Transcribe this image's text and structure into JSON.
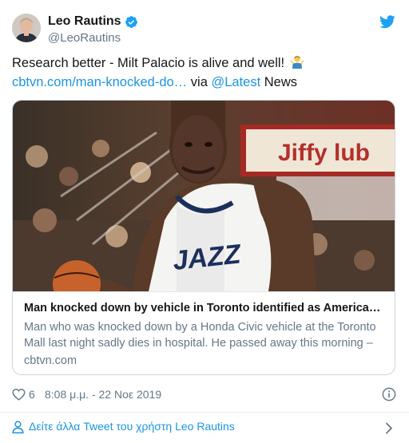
{
  "author": {
    "display_name": "Leo Rautins",
    "handle": "@LeoRautins",
    "verified_icon": "verified-badge-icon",
    "avatar_icon": "avatar"
  },
  "brand_icon": "twitter-bird-icon",
  "tweet": {
    "text_before": "Research better - Milt Palacio is alive and well! ",
    "emoji": "man-shrugging-emoji",
    "link_text": "cbtvn.com/man-knocked-do…",
    "via_text": " via ",
    "mention": "@Latest",
    "after_mention": " News"
  },
  "card": {
    "title": "Man knocked down by vehicle in Toronto identified as American-…",
    "description": "Man who was knocked down by a Honda Civic vehicle at the Toronto Mall last night sadly dies in hospital. He passed away this morning –",
    "domain": "cbtvn.com",
    "image_letters": "JAZZ",
    "image_sign": "Jiffy lub"
  },
  "meta": {
    "likes": "6",
    "timestamp": "8:08 μ.μ. - 22 Νοε 2019"
  },
  "footer": {
    "label": "Δείτε άλλα Tweet του χρήστη Leo Rautins"
  },
  "colors": {
    "link": "#1b95e0",
    "secondary_text": "#657786",
    "border": "#ccd6dd",
    "jersey_trim": "#1c2f5c"
  }
}
